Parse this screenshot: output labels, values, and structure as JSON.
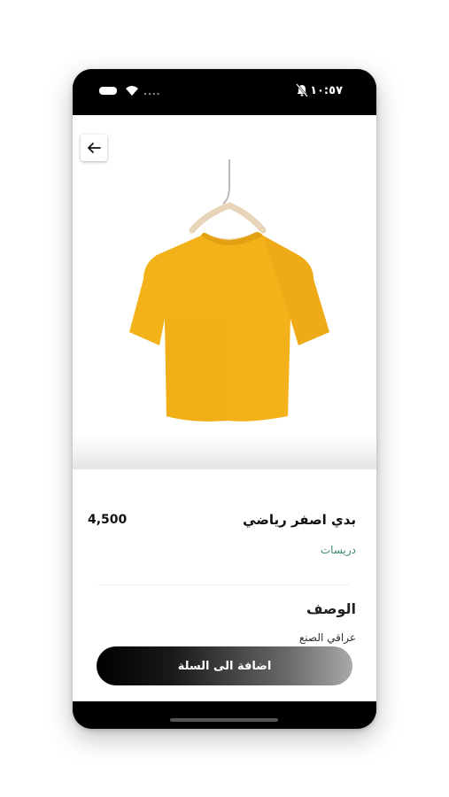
{
  "status_bar": {
    "time": "١٠:٥٧",
    "icons": [
      "battery-icon",
      "wifi-icon",
      "signal-dots-icon",
      "mute-icon"
    ]
  },
  "product": {
    "name": "بدي اصفر رياضي",
    "price": "4,500",
    "category": "دريسات",
    "image_icon": "yellow-tshirt-on-hanger"
  },
  "description": {
    "title": "الوصف",
    "text": "عراقي الصنع"
  },
  "actions": {
    "back_icon": "arrow-left-icon",
    "add_to_cart_label": "اضافة الى السلة"
  },
  "colors": {
    "shirt": "#F4B21A",
    "category_text": "#3A8A70",
    "frame": "#000000"
  }
}
